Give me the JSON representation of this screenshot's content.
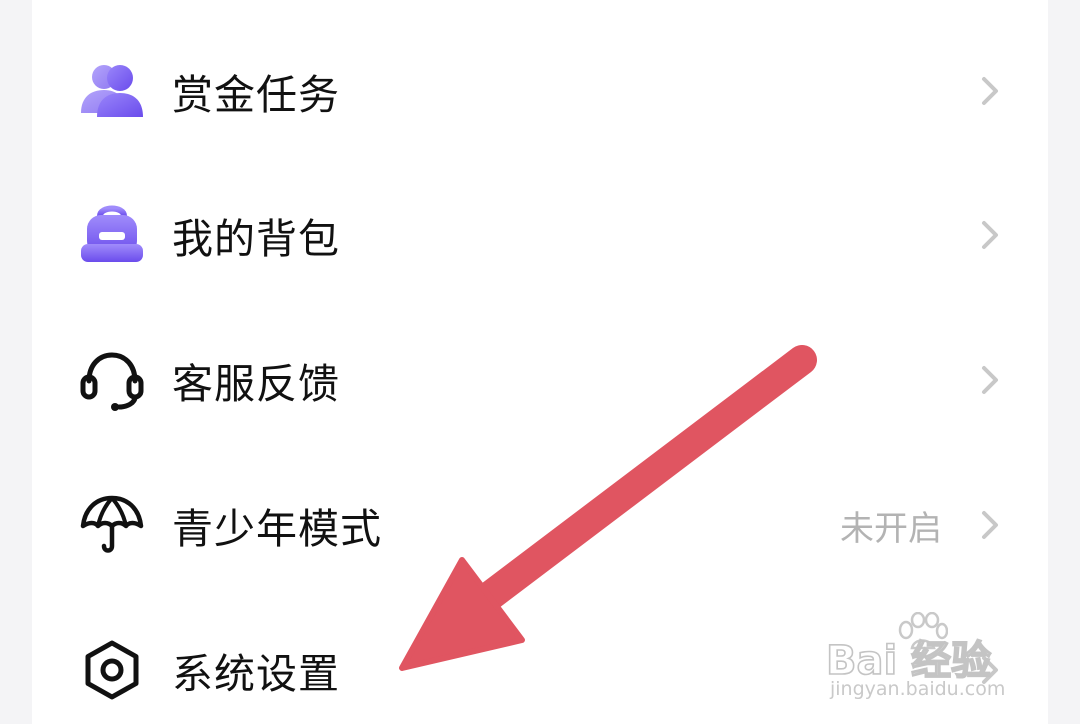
{
  "menu": {
    "items": [
      {
        "id": "bounty",
        "label": "赏金任务",
        "status": "",
        "icon": "users-icon"
      },
      {
        "id": "backpack",
        "label": "我的背包",
        "status": "",
        "icon": "backpack-icon"
      },
      {
        "id": "support",
        "label": "客服反馈",
        "status": "",
        "icon": "headset-icon"
      },
      {
        "id": "youth",
        "label": "青少年模式",
        "status": "未开启",
        "icon": "umbrella-icon"
      },
      {
        "id": "settings",
        "label": "系统设置",
        "status": "",
        "icon": "hexagon-settings-icon"
      }
    ]
  },
  "colors": {
    "accent_gradient_start": "#8e7bf7",
    "accent_gradient_end": "#6f52ee",
    "arrow": "#e05561",
    "status_text": "#b3b3b3",
    "chevron": "#c8c8c8"
  },
  "watermark": {
    "main": "Bai 经验",
    "sub": "jingyan.baidu.com"
  }
}
